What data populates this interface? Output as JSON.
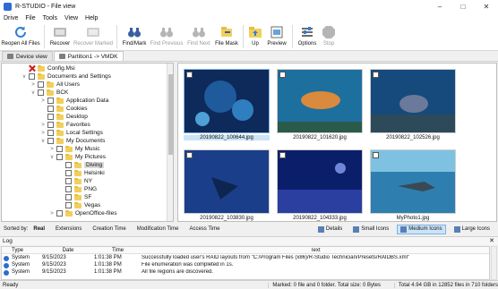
{
  "window": {
    "title": "R-STUDIO - File view"
  },
  "menu": [
    "Drive",
    "File",
    "Tools",
    "View",
    "Help"
  ],
  "toolbar": {
    "reopen": "Reopen All Files",
    "recover": "Recover",
    "recover_marked": "Recover Marked",
    "find_mark": "Find/Mark",
    "find_previous": "Find Previous",
    "find_next": "Find Next",
    "file_mask": "File Mask",
    "up": "Up",
    "preview": "Preview",
    "options": "Options",
    "stop": "Stop"
  },
  "tabs": {
    "device_view": "Device view",
    "partition": "Partition1 -> VMDK"
  },
  "tree": [
    {
      "label": "Config.Msi",
      "check": "x"
    },
    {
      "label": "Documents and Settings",
      "expander": "v"
    },
    {
      "label": "All Users",
      "expander": ">"
    },
    {
      "label": "BCK",
      "expander": "v"
    },
    {
      "label": "Application Data",
      "expander": ">"
    },
    {
      "label": "Cookies"
    },
    {
      "label": "Desktop"
    },
    {
      "label": "Favorites",
      "expander": ">"
    },
    {
      "label": "Local Settings",
      "expander": ">"
    },
    {
      "label": "My Documents",
      "expander": "v"
    },
    {
      "label": "My Music",
      "expander": ">"
    },
    {
      "label": "My Pictures",
      "expander": "v"
    },
    {
      "label": "Diving",
      "selected": true
    },
    {
      "label": "Helsinki"
    },
    {
      "label": "NY"
    },
    {
      "label": "PNG"
    },
    {
      "label": "SF"
    },
    {
      "label": "Vegas"
    },
    {
      "label": "OpenOffice-files",
      "expander": ">"
    }
  ],
  "gallery": [
    {
      "caption": "20190822_100644.jpg",
      "selected": true
    },
    {
      "caption": "20190822_101620.jpg"
    },
    {
      "caption": "20190822_102526.jpg"
    },
    {
      "caption": "20190822_103830.jpg"
    },
    {
      "caption": "20190822_104333.jpg"
    },
    {
      "caption": "MyPhoto1.jpg"
    }
  ],
  "sortbar": {
    "label": "Sorted by:",
    "options": [
      "Real",
      "Extensions",
      "Creation Time",
      "Modification Time",
      "Access Time"
    ],
    "views": [
      "Details",
      "Small Icons",
      "Medium Icons",
      "Large Icons"
    ]
  },
  "log": {
    "title": "Log",
    "headers": {
      "type": "Type",
      "date": "Date",
      "time": "Time",
      "text": "Text"
    },
    "rows": [
      {
        "type": "System",
        "date": "9/15/2023",
        "time": "1:01:38 PM",
        "text": "Successfully loaded user's RAID layouts from \"C:/Program Files (x86)/R-Studio Technician/Presets/RAIDBS.xml\""
      },
      {
        "type": "System",
        "date": "9/15/2023",
        "time": "1:01:38 PM",
        "text": "File enumeration was completed in 1s."
      },
      {
        "type": "System",
        "date": "9/15/2023",
        "time": "1:01:38 PM",
        "text": "All file regions are discovered."
      }
    ]
  },
  "status": {
    "ready": "Ready",
    "marked": "Marked: 0 file and 0 folder. Total size: 0 Bytes",
    "total": "Total 4.94 GB in 12852 files in 710 folders"
  }
}
